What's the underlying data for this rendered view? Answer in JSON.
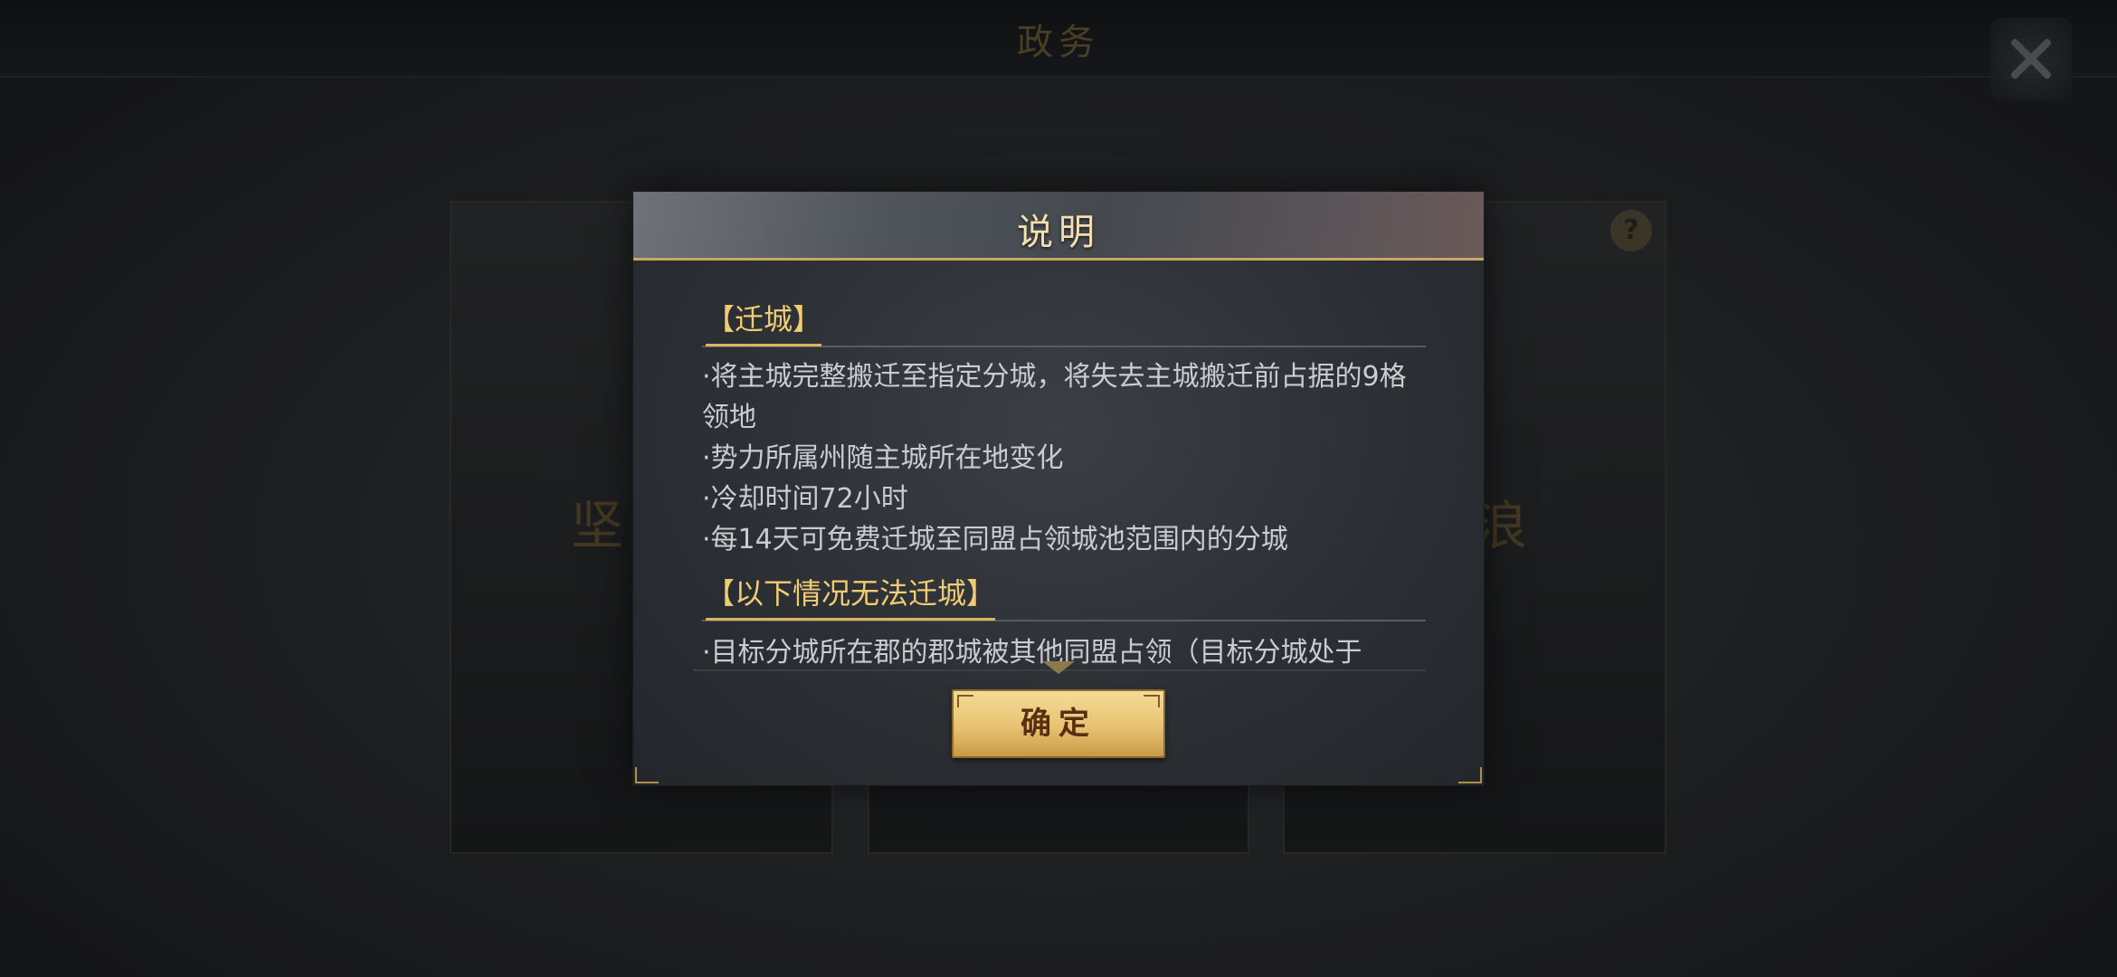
{
  "topbar": {
    "title": "政务"
  },
  "background_cards": [
    {
      "title": "坚守",
      "desc": ""
    },
    {
      "title": "",
      "desc": ""
    },
    {
      "title": "流浪",
      "desc": ""
    }
  ],
  "dialog": {
    "title": "说明",
    "sections": [
      {
        "heading": "【迁城】",
        "lines": [
          "·将主城完整搬迁至指定分城，将失去主城搬迁前占据的9格领地",
          "·势力所属州随主城所在地变化",
          "·冷却时间72小时",
          "·每14天可免费迁城至同盟占领城池范围内的分城"
        ]
      },
      {
        "heading": "【以下情况无法迁城】",
        "lines": [
          "·目标分城所在郡的郡城被其他同盟占领（目标分城处于"
        ]
      }
    ],
    "confirm_label": "确定"
  },
  "colors": {
    "accent_gold": "#f0cd72",
    "button_gold": "#e8c272",
    "body_text": "#c9ccd0"
  }
}
